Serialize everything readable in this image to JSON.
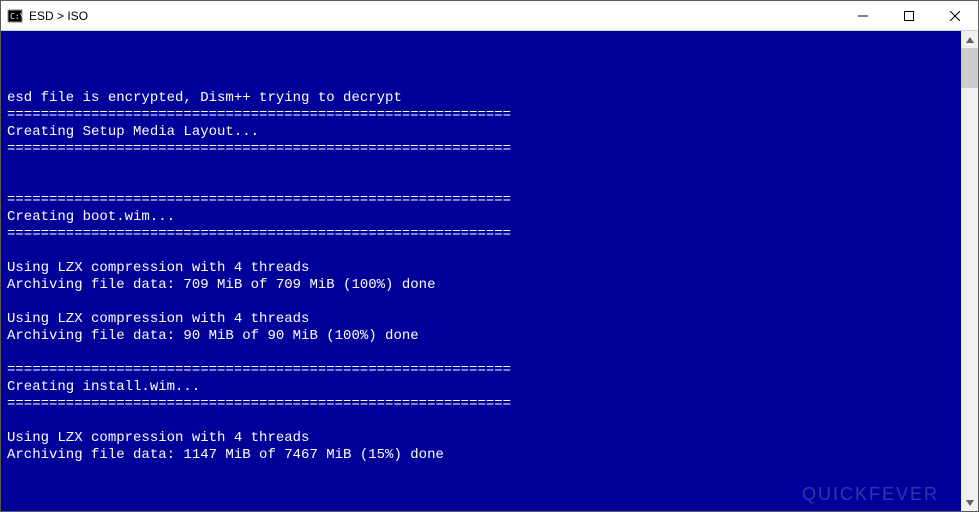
{
  "window": {
    "title": "ESD > ISO"
  },
  "console": {
    "lines": [
      "",
      "esd file is encrypted, Dism++ trying to decrypt",
      "============================================================",
      "Creating Setup Media Layout...",
      "============================================================",
      "",
      "",
      "============================================================",
      "Creating boot.wim...",
      "============================================================",
      "",
      "Using LZX compression with 4 threads",
      "Archiving file data: 709 MiB of 709 MiB (100%) done",
      "",
      "Using LZX compression with 4 threads",
      "Archiving file data: 90 MiB of 90 MiB (100%) done",
      "",
      "============================================================",
      "Creating install.wim...",
      "============================================================",
      "",
      "Using LZX compression with 4 threads",
      "Archiving file data: 1147 MiB of 7467 MiB (15%) done"
    ]
  },
  "watermark": "QUICKFEVER"
}
